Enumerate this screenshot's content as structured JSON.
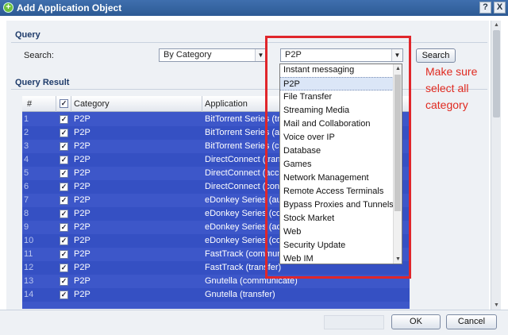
{
  "window": {
    "title": "Add Application Object",
    "help_label": "?",
    "close_label": "X"
  },
  "query": {
    "section_label": "Query",
    "search_label": "Search:",
    "search_by_value": "By Category",
    "category_value": "P2P",
    "search_button_label": "Search"
  },
  "result": {
    "section_label": "Query Result",
    "columns": {
      "num": "#",
      "category": "Category",
      "application": "Application"
    },
    "rows": [
      {
        "num": "1",
        "category": "P2P",
        "application": "BitTorrent Series (trans"
      },
      {
        "num": "2",
        "category": "P2P",
        "application": "BitTorrent Series (aut"
      },
      {
        "num": "3",
        "category": "P2P",
        "application": "BitTorrent Series (co"
      },
      {
        "num": "4",
        "category": "P2P",
        "application": "DirectConnect (trans"
      },
      {
        "num": "5",
        "category": "P2P",
        "application": "DirectConnect (acc"
      },
      {
        "num": "6",
        "category": "P2P",
        "application": "DirectConnect (conn"
      },
      {
        "num": "7",
        "category": "P2P",
        "application": "eDonkey Series (aut"
      },
      {
        "num": "8",
        "category": "P2P",
        "application": "eDonkey Series (con"
      },
      {
        "num": "9",
        "category": "P2P",
        "application": "eDonkey Series (acc"
      },
      {
        "num": "10",
        "category": "P2P",
        "application": "eDonkey Series (co"
      },
      {
        "num": "11",
        "category": "P2P",
        "application": "FastTrack (commun"
      },
      {
        "num": "12",
        "category": "P2P",
        "application": "FastTrack (transfer)"
      },
      {
        "num": "13",
        "category": "P2P",
        "application": "Gnutella (communicate)"
      },
      {
        "num": "14",
        "category": "P2P",
        "application": "Gnutella (transfer)"
      }
    ]
  },
  "dropdown": {
    "items": [
      "Instant messaging",
      "P2P",
      "File Transfer",
      "Streaming Media",
      "Mail and Collaboration",
      "Voice over IP",
      "Database",
      "Games",
      "Network Management",
      "Remote Access Terminals",
      "Bypass Proxies and Tunnels",
      "Stock Market",
      "Web",
      "Security Update",
      "Web IM"
    ],
    "selected_index": 1
  },
  "annotation": {
    "lines": [
      "Make sure",
      "select all",
      "category"
    ]
  },
  "footer": {
    "ok_label": "OK",
    "cancel_label": "Cancel"
  },
  "icons": {
    "check": "✓",
    "arrow_down": "▼",
    "arrow_up": "▲"
  },
  "colors": {
    "grid_selection": "#3d57c9",
    "annotation_red": "#e0262b",
    "title_bar": "#3f6fae"
  }
}
